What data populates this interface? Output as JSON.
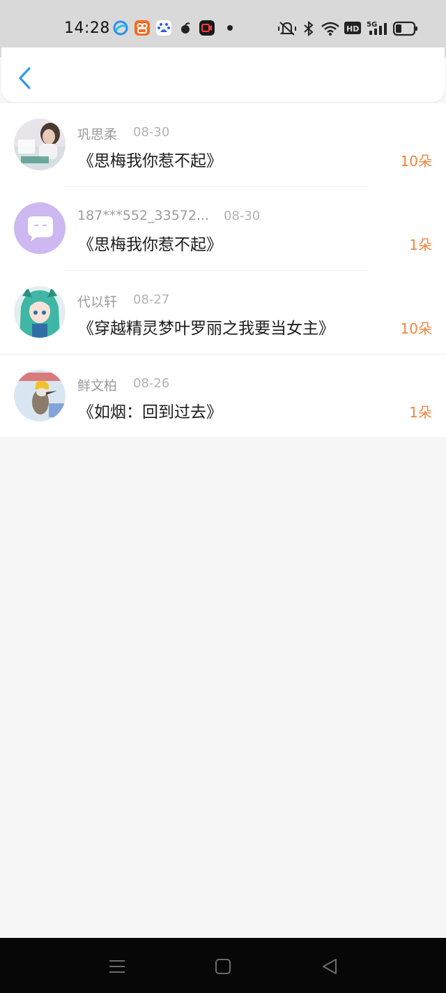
{
  "status_bar": {
    "time": "14:28",
    "app_icons": [
      "browser-app-icon",
      "kuaishou-app-icon",
      "baidu-app-icon",
      "peach-app-icon",
      "screen-record-icon",
      "dot-icon"
    ],
    "indicators": [
      "mute-vibrate-icon",
      "bluetooth-icon",
      "wifi-icon",
      "hd-icon",
      "5g-signal-icon",
      "battery-icon"
    ],
    "hd_label": "HD",
    "network_label": "5G"
  },
  "header": {
    "back_icon": "chevron-left-icon"
  },
  "list": {
    "items": [
      {
        "name": "巩思柔",
        "date": "08-30",
        "title": "《思梅我你惹不起》",
        "count": "10朵",
        "avatar": "photo-avatar"
      },
      {
        "name": "187***552_33572...",
        "date": "08-30",
        "title": "《思梅我你惹不起》",
        "count": "1朵",
        "avatar": "default-chat-avatar"
      },
      {
        "name": "代以轩",
        "date": "08-27",
        "title": "《穿越精灵梦叶罗丽之我要当女主》",
        "count": "10朵",
        "avatar": "anime-avatar"
      },
      {
        "name": "鲜文柏",
        "date": "08-26",
        "title": "《如烟：回到过去》",
        "count": "1朵",
        "avatar": "bird-avatar"
      }
    ]
  },
  "nav_bar": {
    "buttons": [
      "menu-icon",
      "home-icon",
      "back-icon"
    ]
  },
  "colors": {
    "accent": "#f0843c",
    "back_arrow": "#2f9be6",
    "page_bg": "#f7f6f7"
  }
}
